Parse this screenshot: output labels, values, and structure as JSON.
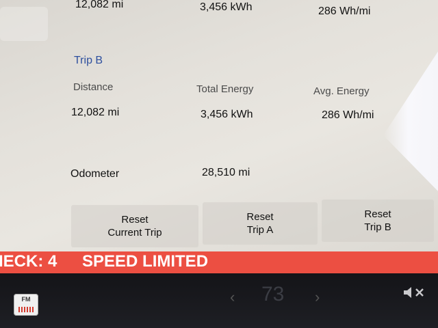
{
  "trip_a": {
    "distance": "12,082 mi",
    "total_energy": "3,456 kWh",
    "avg_energy": "286 Wh/mi"
  },
  "trip_b": {
    "title": "Trip B",
    "distance_label": "Distance",
    "total_energy_label": "Total Energy",
    "avg_energy_label": "Avg. Energy",
    "distance": "12,082  mi",
    "total_energy": "3,456  kWh",
    "avg_energy": "286  Wh/mi"
  },
  "odometer": {
    "label": "Odometer",
    "value": "28,510  mi"
  },
  "buttons": {
    "reset_current_line1": "Reset",
    "reset_current_line2": "Current Trip",
    "reset_a_line1": "Reset",
    "reset_a_line2": "Trip A",
    "reset_b_line1": "Reset",
    "reset_b_line2": "Trip B"
  },
  "alert": {
    "left_text": "IECK: 4",
    "right_text": "SPEED LIMITED",
    "color": "#ec4f42"
  },
  "bottom_bar": {
    "radio_label": "FM",
    "radio_icon": "fm-radio-icon",
    "temperature": "73",
    "left_chevron": "‹",
    "right_chevron": "›",
    "mute_icon": "speaker-muted-icon"
  },
  "colors": {
    "section_title": "#2d4f9e",
    "screen_bg": "#e4e1db"
  }
}
